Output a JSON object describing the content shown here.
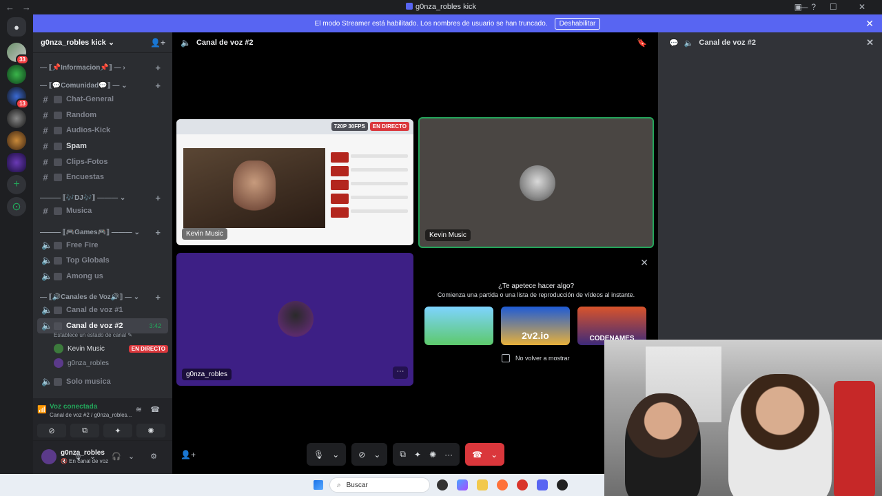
{
  "titlebar": {
    "title": "g0nza_robles kick",
    "back": "←",
    "forward": "→",
    "inbox_icon": "▣",
    "help_icon": "?",
    "window_controls": "— ☐ ✕"
  },
  "banner": {
    "text": "El modo Streamer está habilitado. Los nombres de usuario se han truncado.",
    "button": "Deshabilitar",
    "close": "✕"
  },
  "servers": [
    {
      "badge": "33"
    },
    {
      "badge": ""
    },
    {
      "badge": "13"
    },
    {
      "badge": ""
    },
    {
      "badge": ""
    },
    {
      "badge": ""
    }
  ],
  "guild": {
    "name": "g0nza_robles kick ⌄",
    "invite_icon": "👤+"
  },
  "categories": [
    {
      "label": "— ⟦📌Informacion📌⟧ — ›"
    },
    {
      "label": "— ⟦💬Comunidad💬⟧ — ⌄"
    },
    {
      "label": "——— ⟦🎶DJ🎶⟧ ——— ⌄"
    },
    {
      "label": "——— ⟦🎮Games🎮⟧ ——— ⌄"
    },
    {
      "label": "— ⟦🔊Canales de Voz🔊⟧ — ⌄"
    }
  ],
  "text_channels": [
    "Chat-General",
    "Random",
    "Audios-Kick",
    "Spam",
    "Clips-Fotos",
    "Encuestas"
  ],
  "music_channels": [
    "Musica"
  ],
  "game_channels": [
    "Free Fire",
    "Top Globals",
    "Among us"
  ],
  "voice_channels": {
    "ch1": "Canal de voz #1",
    "ch2": "Canal de voz #2",
    "ch2_time": "3:42",
    "ch2_status": "Establece un estado de canal ✎",
    "ch3": "Solo musica"
  },
  "voice_users": [
    {
      "name": "Kevin Music",
      "live": "EN DIRECTO"
    },
    {
      "name": "g0nza_robles",
      "live": ""
    }
  ],
  "voice_panel": {
    "connected": "Voz conectada",
    "channel": "Canal de voz #2 / g0nza_robles...",
    "btn_video": "⊘",
    "btn_share": "⧉",
    "btn_activity": "✦",
    "btn_sound": "✺"
  },
  "user_panel": {
    "name": "g0nza_robles",
    "status": "🔇 En canal de voz",
    "controls": "🎙⌄ 🎧⌄ ⚙"
  },
  "stage": {
    "header": "Canal de voz #2",
    "bookmark_icon": "🔖",
    "tiles": [
      {
        "label": "Kevin Music",
        "quality": "720P 30FPS",
        "live": "EN DIRECTO"
      },
      {
        "label": "Kevin Music"
      },
      {
        "label": "g0nza_robles",
        "more": "···"
      }
    ],
    "activity": {
      "title": "¿Te apetece hacer algo?",
      "subtitle": "Comienza una partida o una lista de reproducción de vídeos al instante.",
      "games": [
        "",
        "2v2.io",
        "CODENAMES"
      ],
      "checkbox": "No volver a mostrar",
      "close": "✕"
    },
    "controls": {
      "mic": "🎙",
      "cam": "⊘",
      "share": "⧉",
      "activity": "✦",
      "sound": "✺",
      "more": "···",
      "hangup": "☎",
      "add_people": "👤+"
    }
  },
  "right_panel": {
    "header": "Canal de voz #2",
    "close": "✕"
  },
  "taskbar": {
    "search": "Buscar"
  }
}
